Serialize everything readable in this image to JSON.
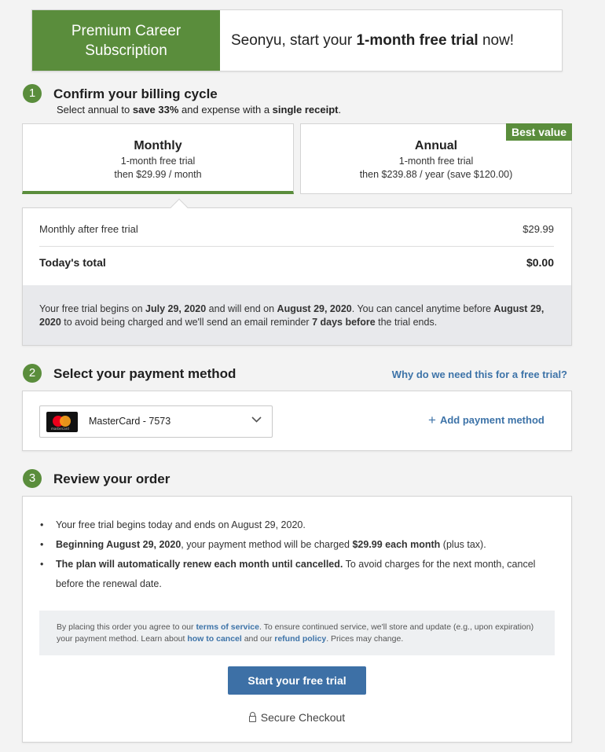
{
  "banner": {
    "product_line1": "Premium Career",
    "product_line2": "Subscription",
    "greeting_pre": "Seonyu, start your ",
    "greeting_bold": "1-month free trial",
    "greeting_post": " now!"
  },
  "step1": {
    "number": "1",
    "title": "Confirm your billing cycle",
    "subtitle_pre": "Select annual to ",
    "subtitle_bold1": "save 33%",
    "subtitle_mid": " and expense with a ",
    "subtitle_bold2": "single receipt",
    "subtitle_post": "."
  },
  "plans": {
    "monthly": {
      "name": "Monthly",
      "line1": "1-month free trial",
      "line2": "then $29.99 / month",
      "selected": true
    },
    "annual": {
      "name": "Annual",
      "line1": "1-month free trial",
      "line2": "then $239.88 / year (save $120.00)",
      "badge": "Best value",
      "selected": false
    }
  },
  "summary": {
    "row_label": "Monthly after free trial",
    "row_amount": "$29.99",
    "total_label": "Today's total",
    "total_amount": "$0.00",
    "note_p1": "Your free trial begins on ",
    "note_b1": "July 29, 2020",
    "note_p2": " and will end on ",
    "note_b2": "August 29, 2020",
    "note_p3": ". You can cancel anytime before ",
    "note_b3": "August 29, 2020",
    "note_p4": " to avoid being charged and we'll send an email reminder ",
    "note_b4": "7 days before",
    "note_p5": " the trial ends."
  },
  "step2": {
    "number": "2",
    "title": "Select your payment method",
    "help_link": "Why do we need this for a free trial?",
    "selected_method": "MasterCard - 7573",
    "card_brand_text": "mastercard",
    "add_method": "Add payment method"
  },
  "step3": {
    "number": "3",
    "title": "Review your order",
    "bullet1": "Your free trial begins today and ends on August 29, 2020.",
    "bullet2_b1": "Beginning August 29, 2020",
    "bullet2_p1": ", your payment method will be charged ",
    "bullet2_b2": "$29.99 each month",
    "bullet2_p2": " (plus tax).",
    "bullet3_b1": "The plan will automatically renew each month until cancelled.",
    "bullet3_p1": " To avoid charges for the next month, cancel before the renewal date.",
    "legal_p1": "By placing this order you agree to our ",
    "legal_link1": "terms of service",
    "legal_p2": ". To ensure continued service, we'll store and update (e.g., upon expiration) your payment method. Learn about ",
    "legal_link2": "how to cancel",
    "legal_p3": " and our ",
    "legal_link3": "refund policy",
    "legal_p4": ". Prices may change.",
    "cta": "Start your free trial",
    "secure": "Secure Checkout"
  },
  "colors": {
    "brand_green": "#5a8d3c",
    "link_blue": "#3d73a8",
    "cta_blue": "#3d70a6"
  }
}
